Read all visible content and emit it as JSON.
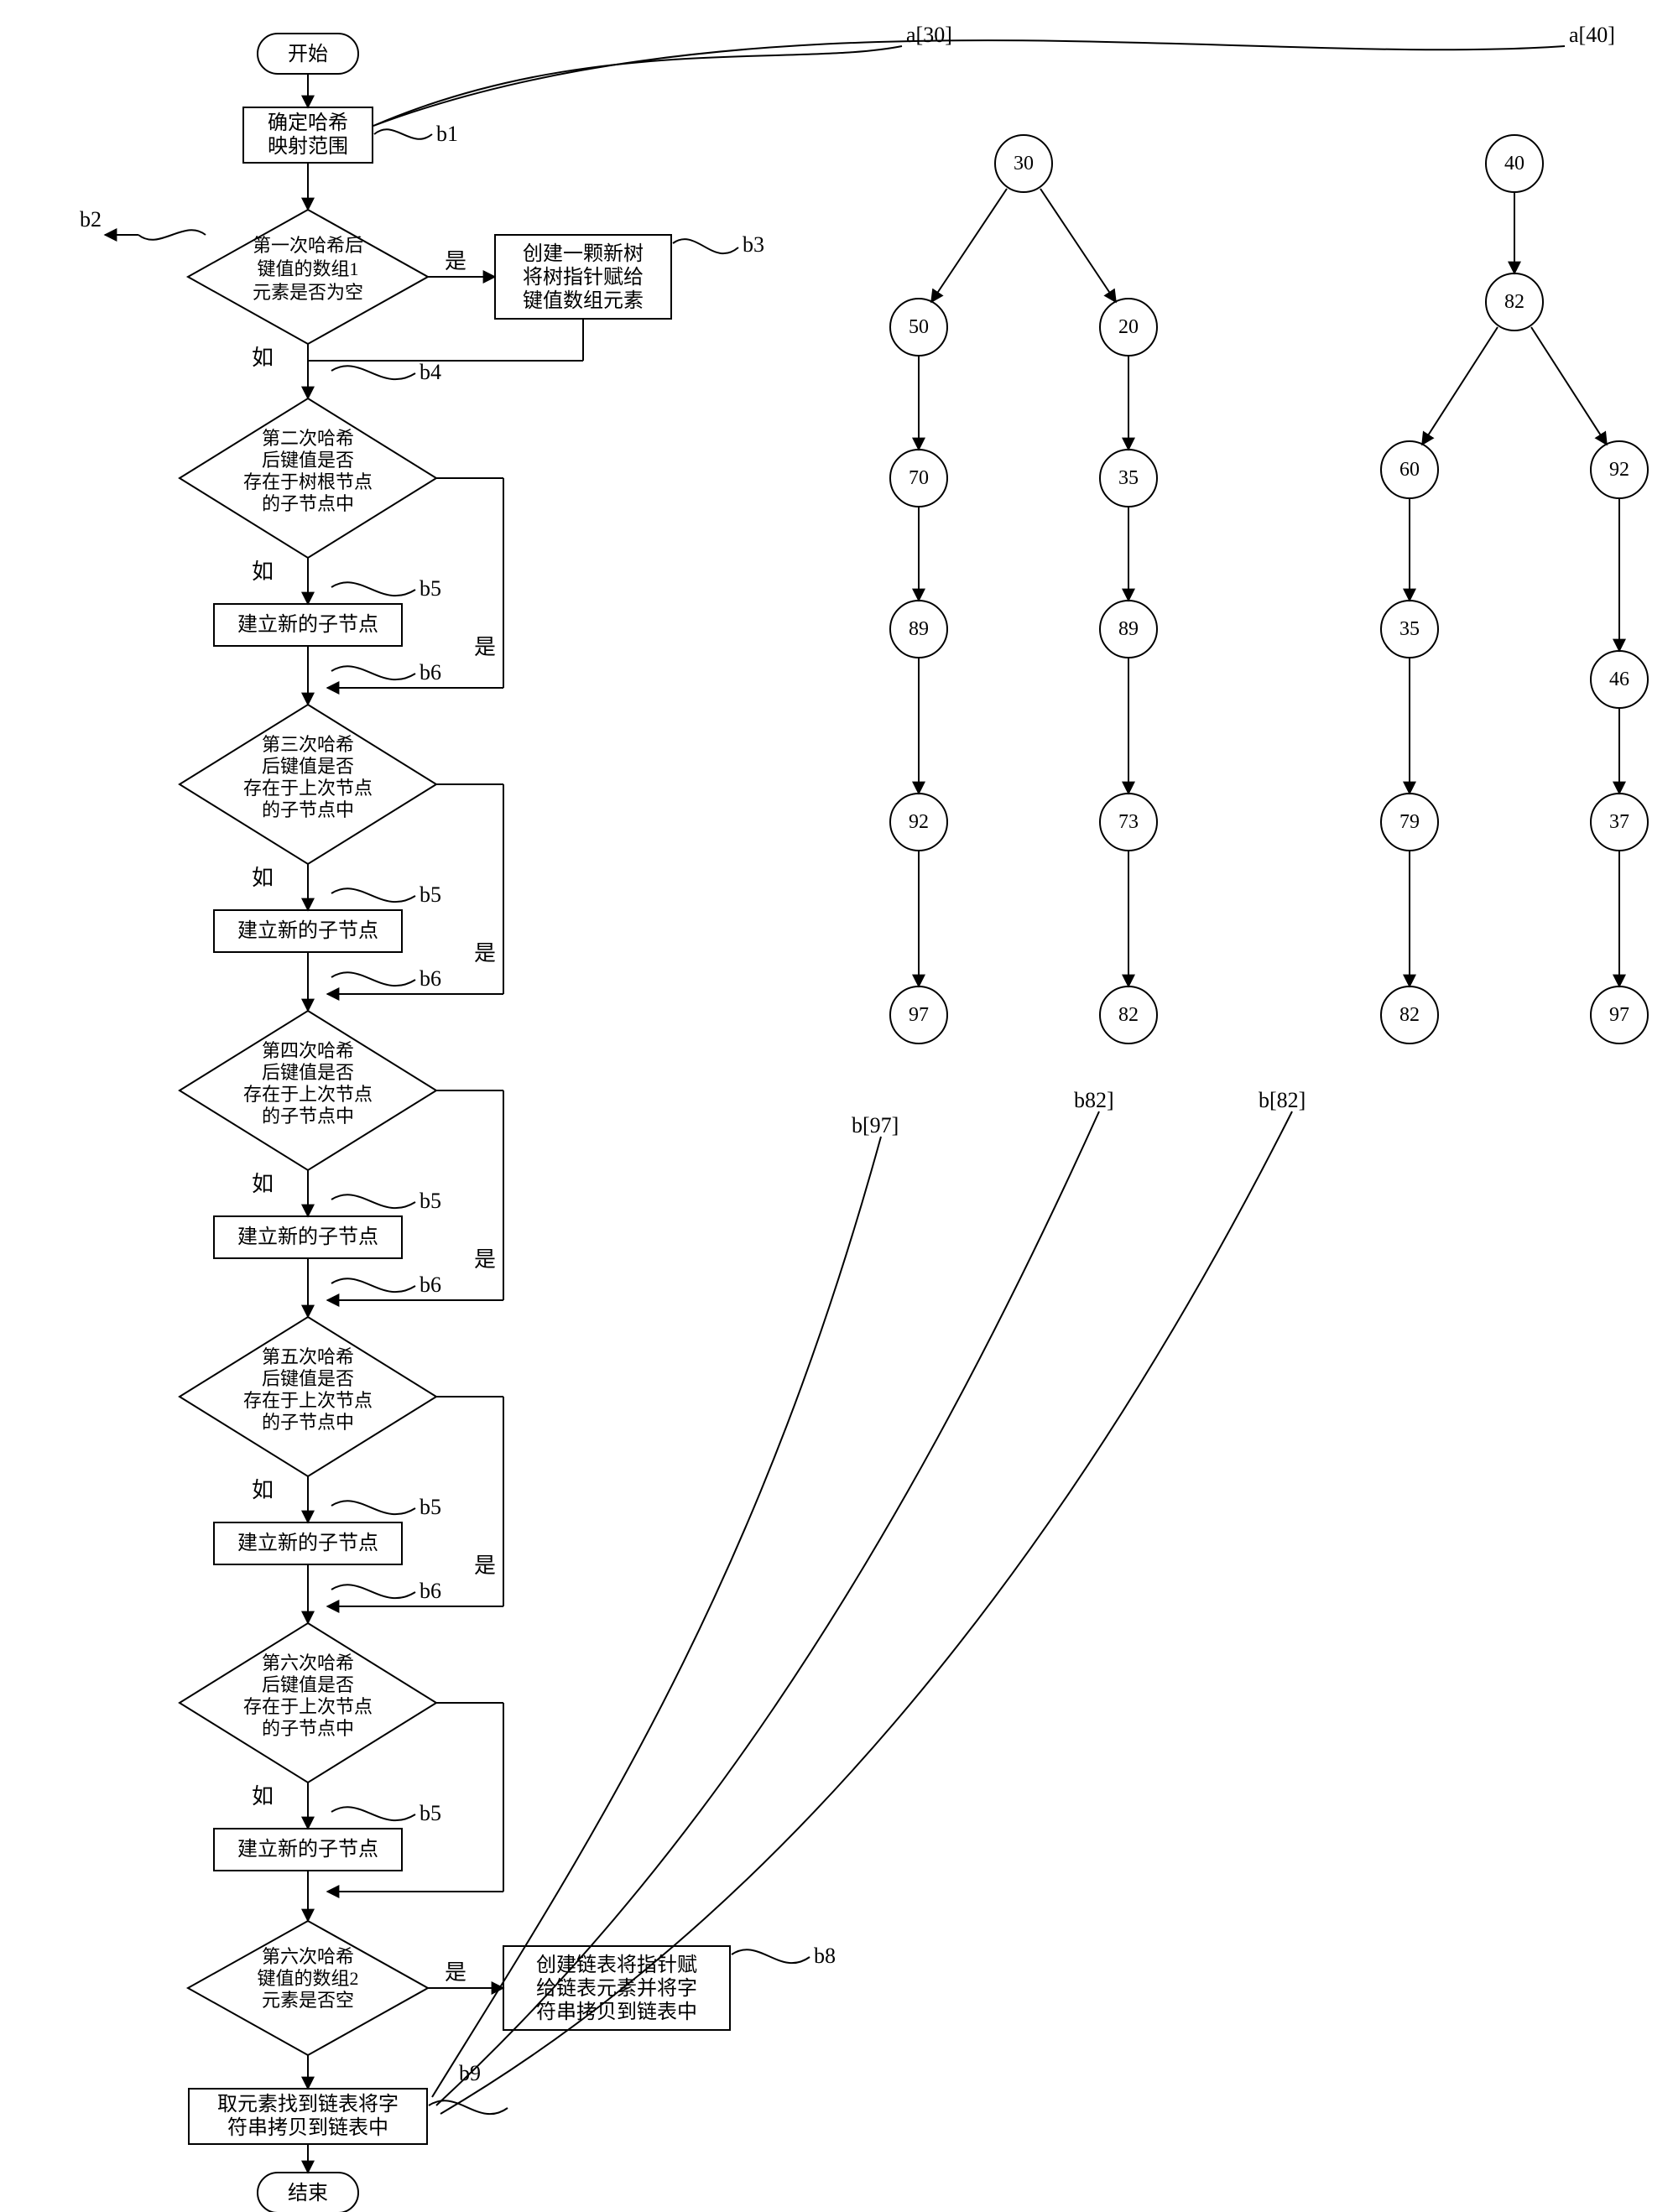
{
  "flow": {
    "start": "开始",
    "end": "结束",
    "b1_box": "确定哈希\n映射范围",
    "d1": "第一次哈希后\n键值的数组1\n元素是否为空",
    "b3_box": "创建一颗新树\n将树指针赋给\n键值数组元素",
    "d2": "第二次哈希\n后键值是否\n存在于树根节点\n的子节点中",
    "b5_box": "建立新的子节点",
    "d3": "第三次哈希\n后键值是否\n存在于上次节点\n的子节点中",
    "d4": "第四次哈希\n后键值是否\n存在于上次节点\n的子节点中",
    "d5": "第五次哈希\n后键值是否\n存在于上次节点\n的子节点中",
    "d6": "第六次哈希\n后键值是否\n存在于上次节点\n的子节点中",
    "d7": "第六次哈希\n键值的数组2\n元素是否空",
    "b8_box": "创建链表将指针赋\n给链表元素并将字\n符串拷贝到链表中",
    "b9_box": "取元素找到链表将字\n符串拷贝到链表中",
    "yes": "是",
    "no": "如"
  },
  "annot": {
    "b1": "b1",
    "b2": "b2",
    "b3": "b3",
    "b4": "b4",
    "b5": "b5",
    "b6": "b6",
    "b8": "b8",
    "b9": "b9"
  },
  "tree_labels": {
    "a30": "a[30]",
    "a40": "a[40]",
    "b97": "b[97]",
    "b82a": "b82]",
    "b82b": "b[82]"
  },
  "tree": {
    "t30": {
      "root": "30",
      "l1": "50",
      "r1": "20",
      "l2": "70",
      "r2": "35",
      "l3": "89",
      "r3": "89",
      "l4": "92",
      "r4": "73",
      "l5": "97",
      "r5": "82"
    },
    "t40": {
      "root": "40",
      "c1": "82",
      "l1": "60",
      "r1": "92",
      "l2": "35",
      "r2": "46",
      "l3": "79",
      "r3": "37",
      "l4": "82",
      "r4": "97"
    }
  }
}
